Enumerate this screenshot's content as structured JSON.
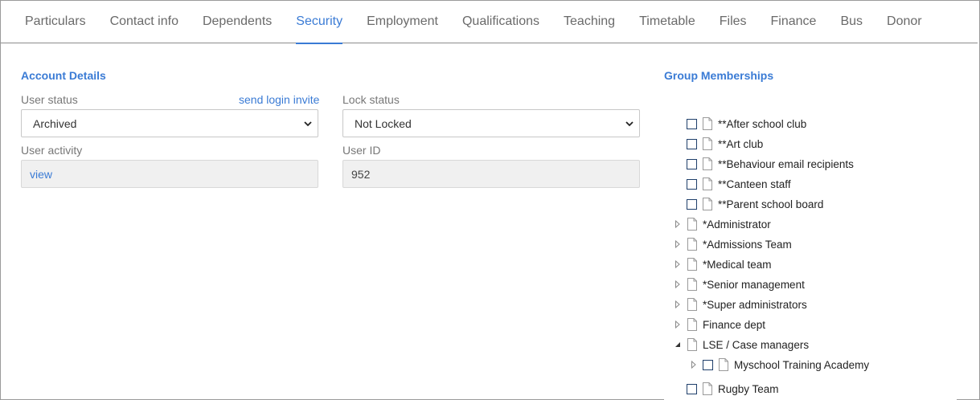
{
  "tabs": [
    "Particulars",
    "Contact info",
    "Dependents",
    "Security",
    "Employment",
    "Qualifications",
    "Teaching",
    "Timetable",
    "Files",
    "Finance",
    "Bus",
    "Donor"
  ],
  "active_tab": "Security",
  "account": {
    "title": "Account Details",
    "user_status_label": "User status",
    "send_invite_link": "send login invite",
    "user_status_value": "Archived",
    "lock_status_label": "Lock status",
    "lock_status_value": "Not Locked",
    "user_activity_label": "User activity",
    "user_activity_link": "view",
    "user_id_label": "User ID",
    "user_id_value": "952"
  },
  "groups": {
    "title": "Group Memberships",
    "items": [
      {
        "label": "**After school club",
        "checkbox": true,
        "expander": "none",
        "level": 0
      },
      {
        "label": "**Art club",
        "checkbox": true,
        "expander": "none",
        "level": 0
      },
      {
        "label": "**Behaviour email recipients",
        "checkbox": true,
        "expander": "none",
        "level": 0
      },
      {
        "label": "**Canteen staff",
        "checkbox": true,
        "expander": "none",
        "level": 0
      },
      {
        "label": "**Parent school board",
        "checkbox": true,
        "expander": "none",
        "level": 0
      },
      {
        "label": "*Administrator",
        "checkbox": false,
        "expander": "collapsed",
        "level": 0
      },
      {
        "label": "*Admissions Team",
        "checkbox": false,
        "expander": "collapsed",
        "level": 0
      },
      {
        "label": "*Medical team",
        "checkbox": false,
        "expander": "collapsed",
        "level": 0
      },
      {
        "label": "*Senior management",
        "checkbox": false,
        "expander": "collapsed",
        "level": 0
      },
      {
        "label": "*Super administrators",
        "checkbox": false,
        "expander": "collapsed",
        "level": 0
      },
      {
        "label": "Finance dept",
        "checkbox": false,
        "expander": "collapsed",
        "level": 0
      },
      {
        "label": "LSE / Case managers",
        "checkbox": false,
        "expander": "expanded",
        "level": 0
      },
      {
        "label": "Myschool Training Academy",
        "checkbox": true,
        "expander": "collapsed",
        "level": 1
      },
      {
        "label": "Rugby Team",
        "checkbox": true,
        "expander": "none",
        "level": 0
      }
    ]
  },
  "colors": {
    "accent": "#3a7bd5",
    "checkbox_border": "#1f3f6b"
  }
}
